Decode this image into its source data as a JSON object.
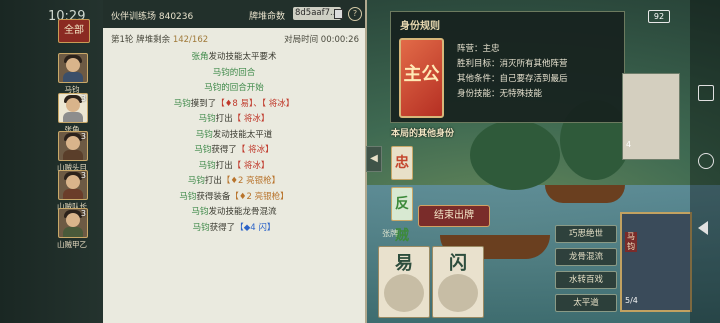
{
  "status": {
    "clock": "10:29",
    "battery": "92"
  },
  "left_panel": {
    "all_tab": "全部",
    "players": [
      {
        "name": "马钧",
        "count": ""
      },
      {
        "name": "张角",
        "count": "3"
      },
      {
        "name": "山贼头目",
        "count": "3"
      },
      {
        "name": "山贼队长",
        "count": "3"
      },
      {
        "name": "山贼甲乙",
        "count": "3"
      }
    ]
  },
  "log": {
    "title": "伙伴训练场 840236",
    "seed_label": "牌堆命数",
    "seed_value": "8d5aaf7...",
    "help": "?",
    "round_label": "第1轮 牌堆剩余",
    "pile_value": "142/162",
    "time_label": "对局时间 00:00:26",
    "lines": [
      {
        "actor": "张角",
        "text": "发动技能太平要术",
        "card": "",
        "tail": ""
      },
      {
        "actor": "马钧",
        "text": "的回合",
        "card": "",
        "tail": ""
      },
      {
        "actor": "马钧",
        "text": "的回合开始",
        "card": "",
        "tail": ""
      },
      {
        "actor": "马钧",
        "text": "摸到了",
        "card": "【♦8 易】、【 将冰】",
        "tail": ""
      },
      {
        "actor": "马钧",
        "text": "打出",
        "card": "【 将冰】",
        "tail": ""
      },
      {
        "actor": "马钧",
        "text": "发动技能太平道",
        "card": "",
        "tail": ""
      },
      {
        "actor": "马钧",
        "text": "获得了",
        "card": "【 将冰】",
        "tail": ""
      },
      {
        "actor": "马钧",
        "text": "打出",
        "card": "【 将冰】",
        "tail": ""
      },
      {
        "actor": "马钧",
        "text": "打出",
        "card": "【♦2 亮银枪】",
        "tail": ""
      },
      {
        "actor": "马钧",
        "text": "获得装备",
        "card": "【♦2 亮银枪】",
        "tail": ""
      },
      {
        "actor": "马钧",
        "text": "发动技能龙骨混流",
        "card": "",
        "tail": ""
      },
      {
        "actor": "马钧",
        "text": "获得了",
        "card": "【◆4 闪】",
        "tail": ""
      }
    ]
  },
  "role_popup": {
    "title": "身份规则",
    "card_char": "主公",
    "camp": "阵营：主忠",
    "win": "胜利目标：消灭所有其他阵营",
    "other": "其他条件：自己要存活到最后",
    "skill": "身份技能：无特殊技能"
  },
  "other_identities": {
    "label": "本局的其他身份",
    "items": [
      "忠臣",
      "反贼"
    ]
  },
  "end_turn": "结束出牌",
  "hand": {
    "label": "张牌",
    "cards": [
      "易",
      "闪"
    ]
  },
  "skills": [
    "巧思绝世",
    "龙骨混流",
    "水转百戏",
    "太平道"
  ],
  "hero": {
    "name": "马钧",
    "hp": "5/4"
  },
  "enemy": {
    "hp": "4"
  }
}
